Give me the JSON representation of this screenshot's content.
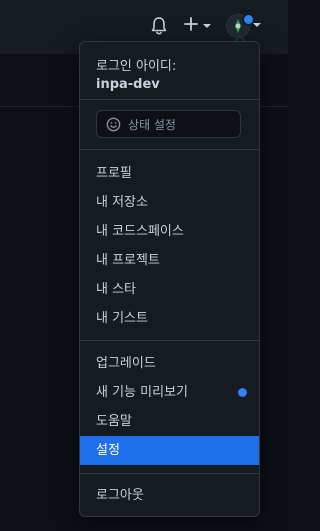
{
  "header": {
    "notifications_icon": "bell-icon",
    "create_icon": "plus-icon",
    "avatar_icon": "avatar"
  },
  "menu": {
    "signed_in_label": "로그인 아이디:",
    "username": "inpa-dev",
    "status": {
      "label": "상태 설정",
      "icon": "smiley-icon"
    },
    "profile_items": [
      {
        "label": "프로필"
      },
      {
        "label": "내 저장소"
      },
      {
        "label": "내 코드스페이스"
      },
      {
        "label": "내 프로젝트"
      },
      {
        "label": "내 스타"
      },
      {
        "label": "내 기스트"
      }
    ],
    "upgrade_label": "업그레이드",
    "feature_preview_label": "새 기능 미리보기",
    "help_label": "도움말",
    "settings_label": "설정",
    "signout_label": "로그아웃"
  },
  "colors": {
    "background": "#0d1117",
    "topbar": "#161b22",
    "menu_border": "#30363d",
    "active_item": "#1f6feb",
    "accent_dot": "#2f81f7",
    "text": "#c9d1d9",
    "muted_text": "#8b949e"
  }
}
